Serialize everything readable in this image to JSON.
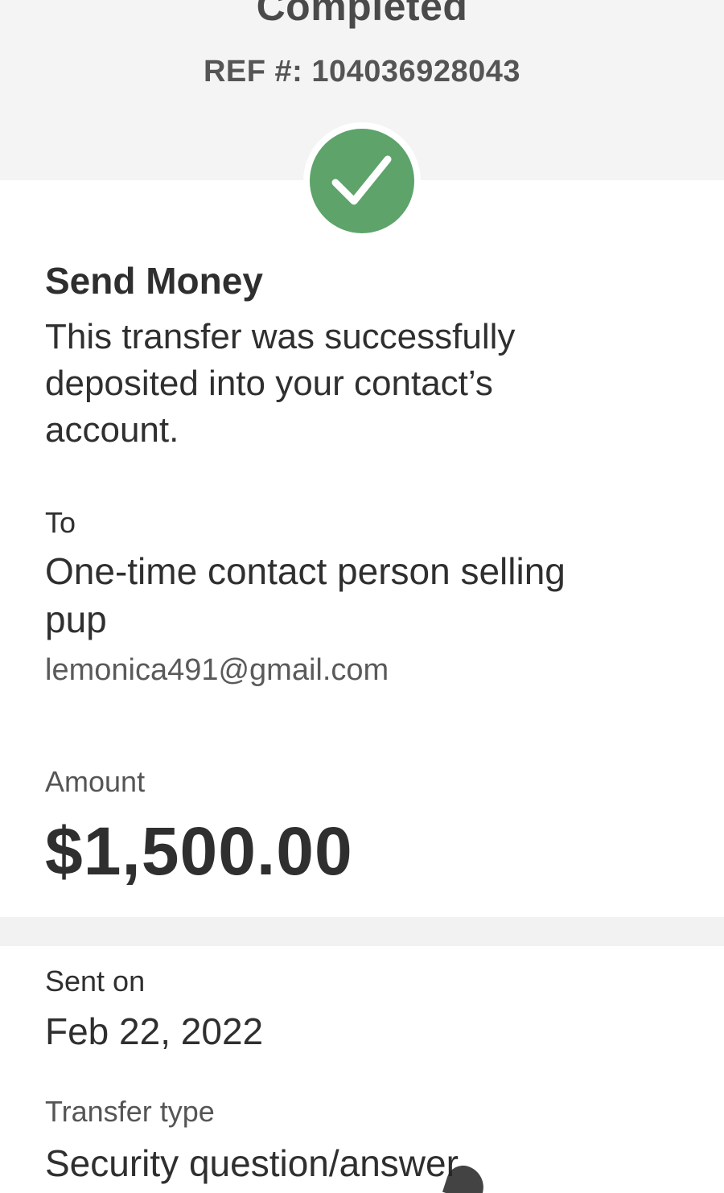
{
  "header": {
    "status_title": "Completed",
    "reference": "REF #: 104036928043"
  },
  "status_icon": "checkmark-icon",
  "colors": {
    "success": "#5da36a",
    "header_background": "#f4f4f4",
    "text": "#2f2f2f",
    "muted_text": "#555555"
  },
  "transfer": {
    "heading": "Send Money",
    "message": "This transfer was successfully deposited into your contact’s account.",
    "to_label": "To",
    "recipient_name": "One-time contact person selling pup",
    "recipient_email": "lemonica491@gmail.com",
    "amount_label": "Amount",
    "amount": "$1,500.00"
  },
  "details": {
    "sent_on_label": "Sent on",
    "sent_on_value": "Feb 22, 2022",
    "transfer_type_label": "Transfer type",
    "transfer_type_value": "Security question/answer"
  }
}
